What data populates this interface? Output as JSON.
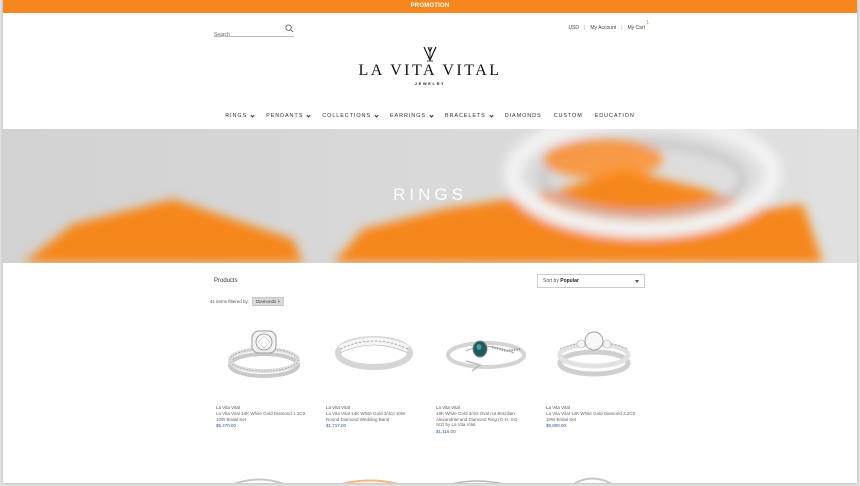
{
  "promo": {
    "text": "PROMOTION",
    "bg": "#f6871f"
  },
  "header": {
    "search_placeholder": "Search",
    "currency": "USD",
    "account": "My Account",
    "cart": "My Cart",
    "cart_count": "1",
    "separator": "|"
  },
  "logo": {
    "name": "LA VITA VITAL",
    "sub": "JEWELRY"
  },
  "nav": {
    "items": [
      {
        "label": "RINGS",
        "dropdown": true
      },
      {
        "label": "PENDANTS",
        "dropdown": true
      },
      {
        "label": "COLLECTIONS",
        "dropdown": true
      },
      {
        "label": "EARRINGS",
        "dropdown": true
      },
      {
        "label": "BRACELETS",
        "dropdown": true
      },
      {
        "label": "DIAMONDS",
        "dropdown": false
      },
      {
        "label": "CUSTOM",
        "dropdown": false
      },
      {
        "label": "EDUCATION",
        "dropdown": false
      }
    ]
  },
  "hero": {
    "title": "RINGS",
    "accent": "#f6871f"
  },
  "listing": {
    "label": "Products",
    "sort_prefix": "Sort by",
    "sort_value": "Popular",
    "filter_text": "41 items filtered by:",
    "filter_chip": "Diamonds ×"
  },
  "products": [
    {
      "brand": "La Vita Vital",
      "name": "La Vita Vital 14K White Gold Diamond 1.3Ctt 10W Bridal Set",
      "price": "$5,470.00",
      "icon": "halo-bridal-set"
    },
    {
      "brand": "La Vita Vital",
      "name": "La Vita Vital 14K White Gold 3/4Ct 10W Round Diamond Wedding Band",
      "price": "$1,717.00",
      "icon": "wedding-band"
    },
    {
      "brand": "La Vita Vital",
      "name": "18K White Gold 3/4ct Oval cut Brazilian Alexandrite and Diamond Ring (G-H, SI1-SI2) by La Vita Vital",
      "price": "$1,116.00",
      "icon": "alexandrite-ring"
    },
    {
      "brand": "La Vita Vital",
      "name": "La Vita Vital 14K White Gold Diamond 3.2Ctt 10W Bridal Set",
      "price": "$5,800.00",
      "icon": "bridal-set"
    }
  ]
}
